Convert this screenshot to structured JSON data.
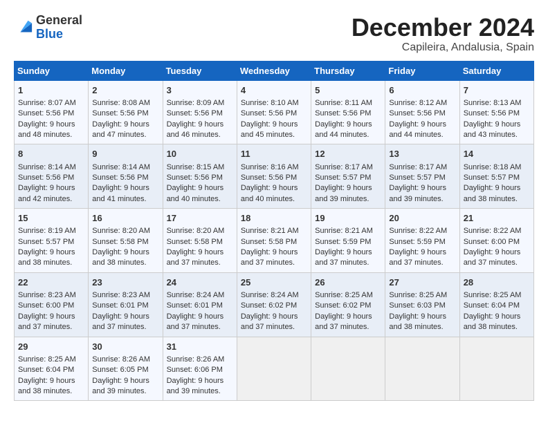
{
  "logo": {
    "general": "General",
    "blue": "Blue"
  },
  "header": {
    "month": "December 2024",
    "location": "Capileira, Andalusia, Spain"
  },
  "weekdays": [
    "Sunday",
    "Monday",
    "Tuesday",
    "Wednesday",
    "Thursday",
    "Friday",
    "Saturday"
  ],
  "weeks": [
    [
      {
        "day": "1",
        "lines": [
          "Sunrise: 8:07 AM",
          "Sunset: 5:56 PM",
          "Daylight: 9 hours",
          "and 48 minutes."
        ]
      },
      {
        "day": "2",
        "lines": [
          "Sunrise: 8:08 AM",
          "Sunset: 5:56 PM",
          "Daylight: 9 hours",
          "and 47 minutes."
        ]
      },
      {
        "day": "3",
        "lines": [
          "Sunrise: 8:09 AM",
          "Sunset: 5:56 PM",
          "Daylight: 9 hours",
          "and 46 minutes."
        ]
      },
      {
        "day": "4",
        "lines": [
          "Sunrise: 8:10 AM",
          "Sunset: 5:56 PM",
          "Daylight: 9 hours",
          "and 45 minutes."
        ]
      },
      {
        "day": "5",
        "lines": [
          "Sunrise: 8:11 AM",
          "Sunset: 5:56 PM",
          "Daylight: 9 hours",
          "and 44 minutes."
        ]
      },
      {
        "day": "6",
        "lines": [
          "Sunrise: 8:12 AM",
          "Sunset: 5:56 PM",
          "Daylight: 9 hours",
          "and 44 minutes."
        ]
      },
      {
        "day": "7",
        "lines": [
          "Sunrise: 8:13 AM",
          "Sunset: 5:56 PM",
          "Daylight: 9 hours",
          "and 43 minutes."
        ]
      }
    ],
    [
      {
        "day": "8",
        "lines": [
          "Sunrise: 8:14 AM",
          "Sunset: 5:56 PM",
          "Daylight: 9 hours",
          "and 42 minutes."
        ]
      },
      {
        "day": "9",
        "lines": [
          "Sunrise: 8:14 AM",
          "Sunset: 5:56 PM",
          "Daylight: 9 hours",
          "and 41 minutes."
        ]
      },
      {
        "day": "10",
        "lines": [
          "Sunrise: 8:15 AM",
          "Sunset: 5:56 PM",
          "Daylight: 9 hours",
          "and 40 minutes."
        ]
      },
      {
        "day": "11",
        "lines": [
          "Sunrise: 8:16 AM",
          "Sunset: 5:56 PM",
          "Daylight: 9 hours",
          "and 40 minutes."
        ]
      },
      {
        "day": "12",
        "lines": [
          "Sunrise: 8:17 AM",
          "Sunset: 5:57 PM",
          "Daylight: 9 hours",
          "and 39 minutes."
        ]
      },
      {
        "day": "13",
        "lines": [
          "Sunrise: 8:17 AM",
          "Sunset: 5:57 PM",
          "Daylight: 9 hours",
          "and 39 minutes."
        ]
      },
      {
        "day": "14",
        "lines": [
          "Sunrise: 8:18 AM",
          "Sunset: 5:57 PM",
          "Daylight: 9 hours",
          "and 38 minutes."
        ]
      }
    ],
    [
      {
        "day": "15",
        "lines": [
          "Sunrise: 8:19 AM",
          "Sunset: 5:57 PM",
          "Daylight: 9 hours",
          "and 38 minutes."
        ]
      },
      {
        "day": "16",
        "lines": [
          "Sunrise: 8:20 AM",
          "Sunset: 5:58 PM",
          "Daylight: 9 hours",
          "and 38 minutes."
        ]
      },
      {
        "day": "17",
        "lines": [
          "Sunrise: 8:20 AM",
          "Sunset: 5:58 PM",
          "Daylight: 9 hours",
          "and 37 minutes."
        ]
      },
      {
        "day": "18",
        "lines": [
          "Sunrise: 8:21 AM",
          "Sunset: 5:58 PM",
          "Daylight: 9 hours",
          "and 37 minutes."
        ]
      },
      {
        "day": "19",
        "lines": [
          "Sunrise: 8:21 AM",
          "Sunset: 5:59 PM",
          "Daylight: 9 hours",
          "and 37 minutes."
        ]
      },
      {
        "day": "20",
        "lines": [
          "Sunrise: 8:22 AM",
          "Sunset: 5:59 PM",
          "Daylight: 9 hours",
          "and 37 minutes."
        ]
      },
      {
        "day": "21",
        "lines": [
          "Sunrise: 8:22 AM",
          "Sunset: 6:00 PM",
          "Daylight: 9 hours",
          "and 37 minutes."
        ]
      }
    ],
    [
      {
        "day": "22",
        "lines": [
          "Sunrise: 8:23 AM",
          "Sunset: 6:00 PM",
          "Daylight: 9 hours",
          "and 37 minutes."
        ]
      },
      {
        "day": "23",
        "lines": [
          "Sunrise: 8:23 AM",
          "Sunset: 6:01 PM",
          "Daylight: 9 hours",
          "and 37 minutes."
        ]
      },
      {
        "day": "24",
        "lines": [
          "Sunrise: 8:24 AM",
          "Sunset: 6:01 PM",
          "Daylight: 9 hours",
          "and 37 minutes."
        ]
      },
      {
        "day": "25",
        "lines": [
          "Sunrise: 8:24 AM",
          "Sunset: 6:02 PM",
          "Daylight: 9 hours",
          "and 37 minutes."
        ]
      },
      {
        "day": "26",
        "lines": [
          "Sunrise: 8:25 AM",
          "Sunset: 6:02 PM",
          "Daylight: 9 hours",
          "and 37 minutes."
        ]
      },
      {
        "day": "27",
        "lines": [
          "Sunrise: 8:25 AM",
          "Sunset: 6:03 PM",
          "Daylight: 9 hours",
          "and 38 minutes."
        ]
      },
      {
        "day": "28",
        "lines": [
          "Sunrise: 8:25 AM",
          "Sunset: 6:04 PM",
          "Daylight: 9 hours",
          "and 38 minutes."
        ]
      }
    ],
    [
      {
        "day": "29",
        "lines": [
          "Sunrise: 8:25 AM",
          "Sunset: 6:04 PM",
          "Daylight: 9 hours",
          "and 38 minutes."
        ]
      },
      {
        "day": "30",
        "lines": [
          "Sunrise: 8:26 AM",
          "Sunset: 6:05 PM",
          "Daylight: 9 hours",
          "and 39 minutes."
        ]
      },
      {
        "day": "31",
        "lines": [
          "Sunrise: 8:26 AM",
          "Sunset: 6:06 PM",
          "Daylight: 9 hours",
          "and 39 minutes."
        ]
      },
      {
        "day": "",
        "lines": []
      },
      {
        "day": "",
        "lines": []
      },
      {
        "day": "",
        "lines": []
      },
      {
        "day": "",
        "lines": []
      }
    ]
  ]
}
